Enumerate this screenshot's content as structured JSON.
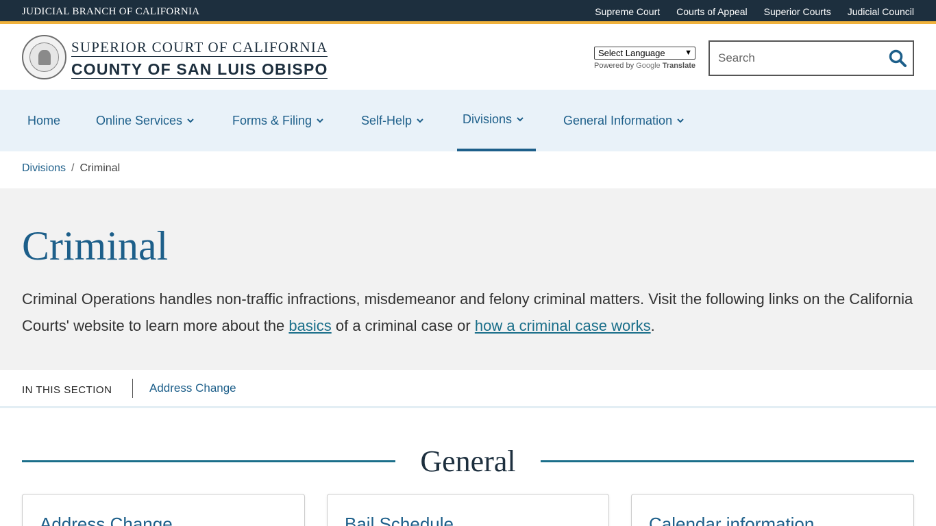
{
  "topbar": {
    "branch": "JUDICIAL BRANCH OF CALIFORNIA",
    "links": [
      "Supreme Court",
      "Courts of Appeal",
      "Superior Courts",
      "Judicial Council"
    ]
  },
  "header": {
    "court_line1": "SUPERIOR COURT OF CALIFORNIA",
    "court_line2": "COUNTY OF SAN LUIS OBISPO",
    "language_select": "Select Language",
    "powered_by": "Powered by",
    "google": "Google",
    "translate": "Translate",
    "search_placeholder": "Search"
  },
  "nav": {
    "items": [
      "Home",
      "Online Services",
      "Forms & Filing",
      "Self-Help",
      "Divisions",
      "General Information"
    ],
    "active": "Divisions"
  },
  "breadcrumb": {
    "parent": "Divisions",
    "separator": "/",
    "current": "Criminal"
  },
  "hero": {
    "title": "Criminal",
    "text_1": "Criminal Operations handles non-traffic infractions, misdemeanor and felony criminal matters. Visit the following links on the California Courts' website to learn more about the ",
    "link_basics": "basics",
    "text_2": " of a criminal case or ",
    "link_how": "how a criminal case works",
    "text_3": "."
  },
  "in_section": {
    "label": "IN THIS SECTION",
    "link": "Address Change"
  },
  "general": {
    "heading": "General",
    "cards": [
      "Address Change",
      "Bail Schedule",
      "Calendar information"
    ]
  },
  "colors": {
    "topbar_bg": "#1d2f3e",
    "topbar_accent": "#f0b23c",
    "nav_bg": "#e9f2f9",
    "link_blue": "#1d5f8a",
    "hero_bg": "#f2f2f2"
  }
}
